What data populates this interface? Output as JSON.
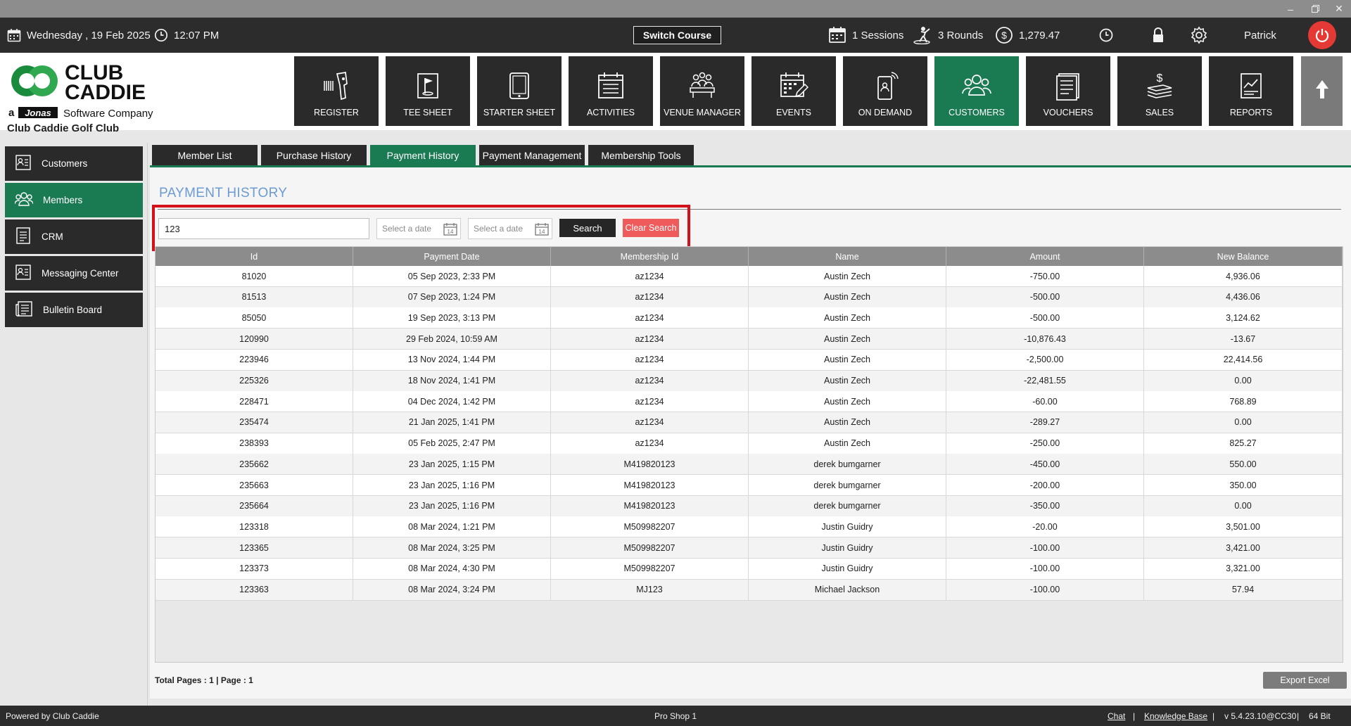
{
  "window": {
    "controls": [
      "minimize",
      "restore",
      "close"
    ]
  },
  "topbar": {
    "date": "Wednesday ,  19 Feb 2025",
    "time": "12:07 PM",
    "switch_course": "Switch Course",
    "sessions": "1 Sessions",
    "rounds": "3 Rounds",
    "balance": "1,279.47",
    "user": "Patrick"
  },
  "brand": {
    "logo_line1": "CLUB",
    "logo_line2": "CADDIE",
    "logo_tagline_a": "a",
    "logo_tagline_jonas": "Jonas",
    "logo_tagline_rest": "Software Company",
    "club_name": "Club Caddie Golf Club"
  },
  "nav": [
    {
      "label": "REGISTER",
      "icon": "barcode-scanner-icon"
    },
    {
      "label": "TEE SHEET",
      "icon": "flag-icon"
    },
    {
      "label": "STARTER SHEET",
      "icon": "tablet-icon"
    },
    {
      "label": "ACTIVITIES",
      "icon": "calendar-list-icon"
    },
    {
      "label": "VENUE MANAGER",
      "icon": "meeting-icon"
    },
    {
      "label": "EVENTS",
      "icon": "calendar-edit-icon"
    },
    {
      "label": "ON DEMAND",
      "icon": "phone-icon"
    },
    {
      "label": "CUSTOMERS",
      "icon": "users-icon",
      "active": true
    },
    {
      "label": "VOUCHERS",
      "icon": "document-icon"
    },
    {
      "label": "SALES",
      "icon": "money-icon"
    },
    {
      "label": "REPORTS",
      "icon": "chart-report-icon"
    }
  ],
  "sidebar": {
    "items": [
      {
        "label": "Customers"
      },
      {
        "label": "Members",
        "active": true
      },
      {
        "label": "CRM"
      },
      {
        "label": "Messaging Center"
      },
      {
        "label": "Bulletin Board"
      }
    ]
  },
  "tabs": [
    {
      "label": "Member List"
    },
    {
      "label": "Purchase History"
    },
    {
      "label": "Payment History",
      "active": true
    },
    {
      "label": "Payment Management"
    },
    {
      "label": "Membership Tools"
    }
  ],
  "page": {
    "title": "PAYMENT HISTORY",
    "search_value": "123",
    "date_from_placeholder": "Select a date",
    "date_to_placeholder": "Select a date",
    "search_label": "Search",
    "clear_label": "Clear Search",
    "total_pages": "Total Pages : 1 | Page : 1",
    "export_label": "Export Excel"
  },
  "table": {
    "headers": [
      "Id",
      "Payment Date",
      "Membership Id",
      "Name",
      "Amount",
      "New Balance"
    ],
    "rows": [
      [
        "81020",
        "05 Sep 2023, 2:33 PM",
        "az1234",
        "Austin  Zech",
        "-750.00",
        "4,936.06"
      ],
      [
        "81513",
        "07 Sep 2023, 1:24 PM",
        "az1234",
        "Austin  Zech",
        "-500.00",
        "4,436.06"
      ],
      [
        "85050",
        "19 Sep 2023, 3:13 PM",
        "az1234",
        "Austin  Zech",
        "-500.00",
        "3,124.62"
      ],
      [
        "120990",
        "29 Feb 2024, 10:59 AM",
        "az1234",
        "Austin  Zech",
        "-10,876.43",
        "-13.67"
      ],
      [
        "223946",
        "13 Nov 2024, 1:44 PM",
        "az1234",
        "Austin  Zech",
        "-2,500.00",
        "22,414.56"
      ],
      [
        "225326",
        "18 Nov 2024, 1:41 PM",
        "az1234",
        "Austin  Zech",
        "-22,481.55",
        "0.00"
      ],
      [
        "228471",
        "04 Dec 2024, 1:42 PM",
        "az1234",
        "Austin  Zech",
        "-60.00",
        "768.89"
      ],
      [
        "235474",
        "21 Jan 2025, 1:41 PM",
        "az1234",
        "Austin  Zech",
        "-289.27",
        "0.00"
      ],
      [
        "238393",
        "05 Feb 2025, 2:47 PM",
        "az1234",
        "Austin  Zech",
        "-250.00",
        "825.27"
      ],
      [
        "235662",
        "23 Jan 2025, 1:15 PM",
        "M419820123",
        "derek  bumgarner",
        "-450.00",
        "550.00"
      ],
      [
        "235663",
        "23 Jan 2025, 1:16 PM",
        "M419820123",
        "derek  bumgarner",
        "-200.00",
        "350.00"
      ],
      [
        "235664",
        "23 Jan 2025, 1:16 PM",
        "M419820123",
        "derek  bumgarner",
        "-350.00",
        "0.00"
      ],
      [
        "123318",
        "08 Mar 2024, 1:21 PM",
        "M509982207",
        "Justin  Guidry",
        "-20.00",
        "3,501.00"
      ],
      [
        "123365",
        "08 Mar 2024, 3:25 PM",
        "M509982207",
        "Justin  Guidry",
        "-100.00",
        "3,421.00"
      ],
      [
        "123373",
        "08 Mar 2024, 4:30 PM",
        "M509982207",
        "Justin  Guidry",
        "-100.00",
        "3,321.00"
      ],
      [
        "123363",
        "08 Mar 2024, 3:24 PM",
        "MJ123",
        "Michael   Jackson",
        "-100.00",
        "57.94"
      ]
    ]
  },
  "footer": {
    "powered_by": "Powered by Club Caddie",
    "location": "Pro Shop 1",
    "chat": "Chat",
    "sep1": "|",
    "knowledge_base": "Knowledge Base",
    "sep2": "|",
    "version": "v 5.4.23.10@CC30",
    "sep3": "|",
    "bits": "64 Bit"
  },
  "colors": {
    "accent": "#1a7a52",
    "highlight": "#d4101a",
    "clear": "#ef5b5b",
    "title": "#6b9bd2"
  }
}
